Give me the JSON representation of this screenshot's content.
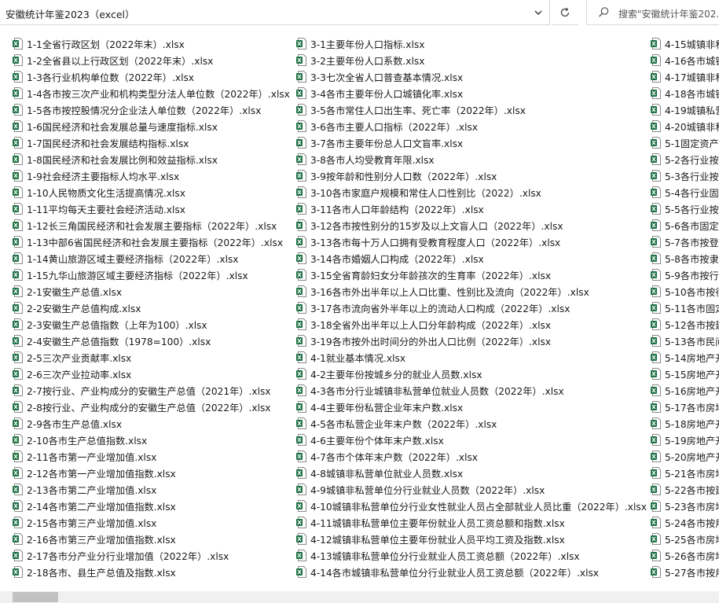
{
  "address_bar": {
    "path": "安徽统计年鉴2023（excel）"
  },
  "search": {
    "placeholder": "搜索\"安徽统计年鉴202..."
  },
  "icons": {
    "file": "excel-file-icon",
    "chevron": "chevron-down-icon",
    "refresh": "refresh-icon",
    "search": "search-icon"
  },
  "colors": {
    "excel_green": "#1e7145",
    "border": "#d9d9d9",
    "scroll_track": "#f0f0f0",
    "scroll_thumb": "#c2c2c2"
  },
  "files": {
    "col1": [
      "1-1全省行政区划（2022年末）.xlsx",
      "1-2全省县以上行政区划（2022年末）.xlsx",
      "1-3各行业机构单位数（2022年）.xlsx",
      "1-4各市按三次产业和机构类型分法人单位数（2022年）.xlsx",
      "1-5各市按控股情况分企业法人单位数（2022年）.xlsx",
      "1-6国民经济和社会发展总量与速度指标.xlsx",
      "1-7国民经济和社会发展结构指标.xlsx",
      "1-8国民经济和社会发展比例和效益指标.xlsx",
      "1-9社会经济主要指标人均水平.xlsx",
      "1-10人民物质文化生活提高情况.xlsx",
      "1-11平均每天主要社会经济活动.xlsx",
      "1-12长三角国民经济和社会发展主要指标（2022年）.xlsx",
      "1-13中部6省国民经济和社会发展主要指标（2022年）.xlsx",
      "1-14黄山旅游区域主要经济指标（2022年）.xlsx",
      "1-15九华山旅游区域主要经济指标（2022年）.xlsx",
      "2-1安徽生产总值.xlsx",
      "2-2安徽生产总值构成.xlsx",
      "2-3安徽生产总值指数（上年为100）.xlsx",
      "2-4安徽生产总值指数（1978=100）.xlsx",
      "2-5三次产业贡献率.xlsx",
      "2-6三次产业拉动率.xlsx",
      "2-7按行业、产业构成分的安徽生产总值（2021年）.xlsx",
      "2-8按行业、产业构成分的安徽生产总值（2022年）.xlsx",
      "2-9各市生产总值.xlsx",
      "2-10各市生产总值指数.xlsx",
      "2-11各市第一产业增加值.xlsx",
      "2-12各市第一产业增加值指数.xlsx",
      "2-13各市第二产业增加值.xlsx",
      "2-14各市第二产业增加值指数.xlsx",
      "2-15各市第三产业增加值.xlsx",
      "2-16各市第三产业增加值指数.xlsx",
      "2-17各市分产业分行业增加值（2022年）.xlsx",
      "2-18各市、县生产总值及指数.xlsx"
    ],
    "col2": [
      "3-1主要年份人口指标.xlsx",
      "3-2主要年份人口系数.xlsx",
      "3-3七次全省人口普查基本情况.xlsx",
      "3-4各市主要年份人口城镇化率.xlsx",
      "3-5各市常住人口出生率、死亡率（2022年）.xlsx",
      "3-6各市主要人口指标（2022年）.xlsx",
      "3-7各市主要年份总人口文盲率.xlsx",
      "3-8各市人均受教育年限.xlsx",
      "3-9按年龄和性别分人口数（2022年）.xlsx",
      "3-10各市家庭户规模和常住人口性别比（2022）.xlsx",
      "3-11各市人口年龄结构（2022年）.xlsx",
      "3-12各市按性别分的15岁及以上文盲人口（2022年）.xlsx",
      "3-13各市每十万人口拥有受教育程度人口（2022年）.xlsx",
      "3-14各市婚姻人口构成（2022年）.xlsx",
      "3-15全省育龄妇女分年龄孩次的生育率（2022年）.xlsx",
      "3-16各市外出半年以上人口比重、性别比及流向（2022年）.xlsx",
      "3-17各市流向省外半年以上的流动人口构成（2022年）.xlsx",
      "3-18全省外出半年以上人口分年龄构成（2022年）.xlsx",
      "3-19各市按外出时间分的外出人口比例（2022年）.xlsx",
      "4-1就业基本情况.xlsx",
      "4-2主要年份按城乡分的就业人员数.xlsx",
      "4-3各市分行业城镇非私营单位就业人员数（2022年）.xlsx",
      "4-4主要年份私营企业年末户数.xlsx",
      "4-5各市私营企业年末户数（2022年）.xlsx",
      "4-6主要年份个体年末户数.xlsx",
      "4-7各市个体年末户数（2022年）.xlsx",
      "4-8城镇非私营单位就业人员数.xlsx",
      "4-9城镇非私营单位分行业就业人员数（2022年）.xlsx",
      "4-10城镇非私营单位分行业女性就业人员占全部就业人员比重（2022年）.xlsx",
      "4-11城镇非私营单位主要年份就业人员工资总额和指数.xlsx",
      "4-12城镇非私营单位主要年份就业人员平均工资及指数.xlsx",
      "4-13城镇非私营单位分行业就业人员工资总额（2022年）.xlsx",
      "4-14各市城镇非私营单位分行业就业人员工资总额（2022年）.xlsx"
    ],
    "col3": [
      "4-15城镇非私",
      "4-16各市城镇",
      "4-17城镇非私",
      "4-18各市城镇",
      "4-19城镇私营",
      "4-20城镇非私",
      "5-1固定资产投",
      "5-2各行业按",
      "5-3各行业按",
      "5-4各行业固",
      "5-5各行业按",
      "5-6各市固定",
      "5-7各市按登",
      "5-8各市按隶",
      "5-9各市按行",
      "5-10各市按行",
      "5-11各市固定",
      "5-12各市按建",
      "5-13各市民间",
      "5-14房地产开",
      "5-15房地产开",
      "5-16房地产开",
      "5-17各市房地",
      "5-18房地产开",
      "5-19房地产开",
      "5-20房地产开",
      "5-21各市房地",
      "5-22各市按建",
      "5-23各市房地",
      "5-24各市按用",
      "5-25各市房地",
      "5-26各市房地",
      "5-27各市按用"
    ]
  }
}
